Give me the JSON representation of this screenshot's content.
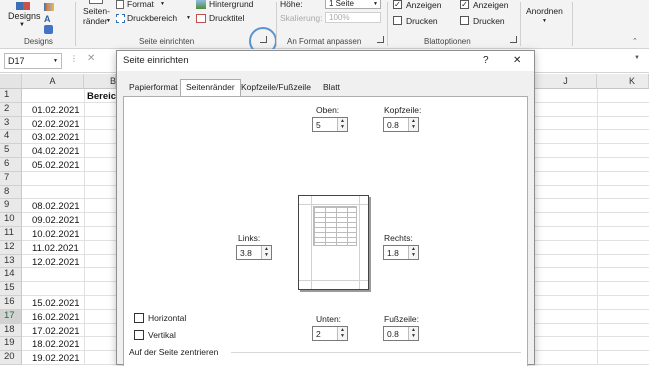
{
  "ribbon": {
    "designs_group": {
      "label": "Designs",
      "button": "Designs"
    },
    "page_setup_group": {
      "label": "Seite einrichten",
      "seitenraender": [
        "Seiten-",
        "ränder"
      ],
      "format": "Format",
      "druckbereich": "Druckbereich",
      "hintergrund": "Hintergrund",
      "drucktitel": "Drucktitel"
    },
    "scale_group": {
      "label": "An Format anpassen",
      "hoehe_label": "Höhe:",
      "hoehe_value": "1 Seite",
      "skalierung_label": "Skalierung:",
      "skalierung_value": "100%"
    },
    "sheet_options_group": {
      "label": "Blattoptionen",
      "col1": {
        "anzeigen": "Anzeigen",
        "drucken": "Drucken"
      },
      "col2": {
        "anzeigen": "Anzeigen",
        "drucken": "Drucken"
      }
    },
    "arrange_group": {
      "label": "Anordnen"
    }
  },
  "formula_bar": {
    "name_box": "D17"
  },
  "sheet": {
    "columns": [
      "A",
      "B",
      "J",
      "K"
    ],
    "b1_text": "Bereich",
    "rows": [
      {
        "num": "1",
        "a": ""
      },
      {
        "num": "2",
        "a": "01.02.2021"
      },
      {
        "num": "3",
        "a": "02.02.2021"
      },
      {
        "num": "4",
        "a": "03.02.2021"
      },
      {
        "num": "5",
        "a": "04.02.2021"
      },
      {
        "num": "6",
        "a": "05.02.2021"
      },
      {
        "num": "7",
        "a": ""
      },
      {
        "num": "8",
        "a": ""
      },
      {
        "num": "9",
        "a": "08.02.2021"
      },
      {
        "num": "10",
        "a": "09.02.2021"
      },
      {
        "num": "11",
        "a": "10.02.2021"
      },
      {
        "num": "12",
        "a": "11.02.2021"
      },
      {
        "num": "13",
        "a": "12.02.2021"
      },
      {
        "num": "14",
        "a": ""
      },
      {
        "num": "15",
        "a": ""
      },
      {
        "num": "16",
        "a": "15.02.2021"
      },
      {
        "num": "17",
        "a": "16.02.2021"
      },
      {
        "num": "18",
        "a": "17.02.2021"
      },
      {
        "num": "19",
        "a": "18.02.2021"
      },
      {
        "num": "20",
        "a": "19.02.2021"
      }
    ]
  },
  "dialog": {
    "title": "Seite einrichten",
    "help": "?",
    "close": "✕",
    "tabs": [
      "Papierformat",
      "Seitenränder",
      "Kopfzeile/Fußzeile",
      "Blatt"
    ],
    "active_tab": 1,
    "fields": {
      "oben": {
        "label": "Oben:",
        "value": "5"
      },
      "kopfzeile": {
        "label": "Kopfzeile:",
        "value": "0.8"
      },
      "links": {
        "label": "Links:",
        "value": "3.8"
      },
      "rechts": {
        "label": "Rechts:",
        "value": "1.8"
      },
      "unten": {
        "label": "Unten:",
        "value": "2"
      },
      "fusszeile": {
        "label": "Fußzeile:",
        "value": "0.8"
      }
    },
    "center": {
      "section_label": "Auf der Seite zentrieren",
      "horizontal": "Horizontal",
      "vertikal": "Vertikal"
    }
  }
}
